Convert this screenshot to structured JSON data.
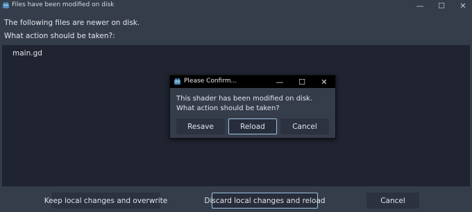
{
  "window": {
    "title": "Files have been modified on disk",
    "minimize_glyph": "—",
    "maximize_glyph": "☐",
    "close_glyph": "✕"
  },
  "main": {
    "line1": "The following files are newer on disk.",
    "line2": "What action should be taken?:",
    "files": [
      "main.gd"
    ],
    "buttons": {
      "keep": "Keep local changes and overwrite",
      "discard": "Discard local changes and reload",
      "cancel": "Cancel"
    }
  },
  "dialog": {
    "title": "Please Confirm...",
    "message1": "This shader has been modified on disk.",
    "message2": "What action should be taken?",
    "buttons": {
      "resave": "Resave",
      "reload": "Reload",
      "cancel": "Cancel"
    }
  },
  "icons": {
    "app": "godot-icon"
  },
  "colors": {
    "background": "#363d4a",
    "list_background": "#1f2430",
    "button": "#2c3240",
    "focus_border": "#9cc4e8",
    "dialog_titlebar": "#000000"
  }
}
